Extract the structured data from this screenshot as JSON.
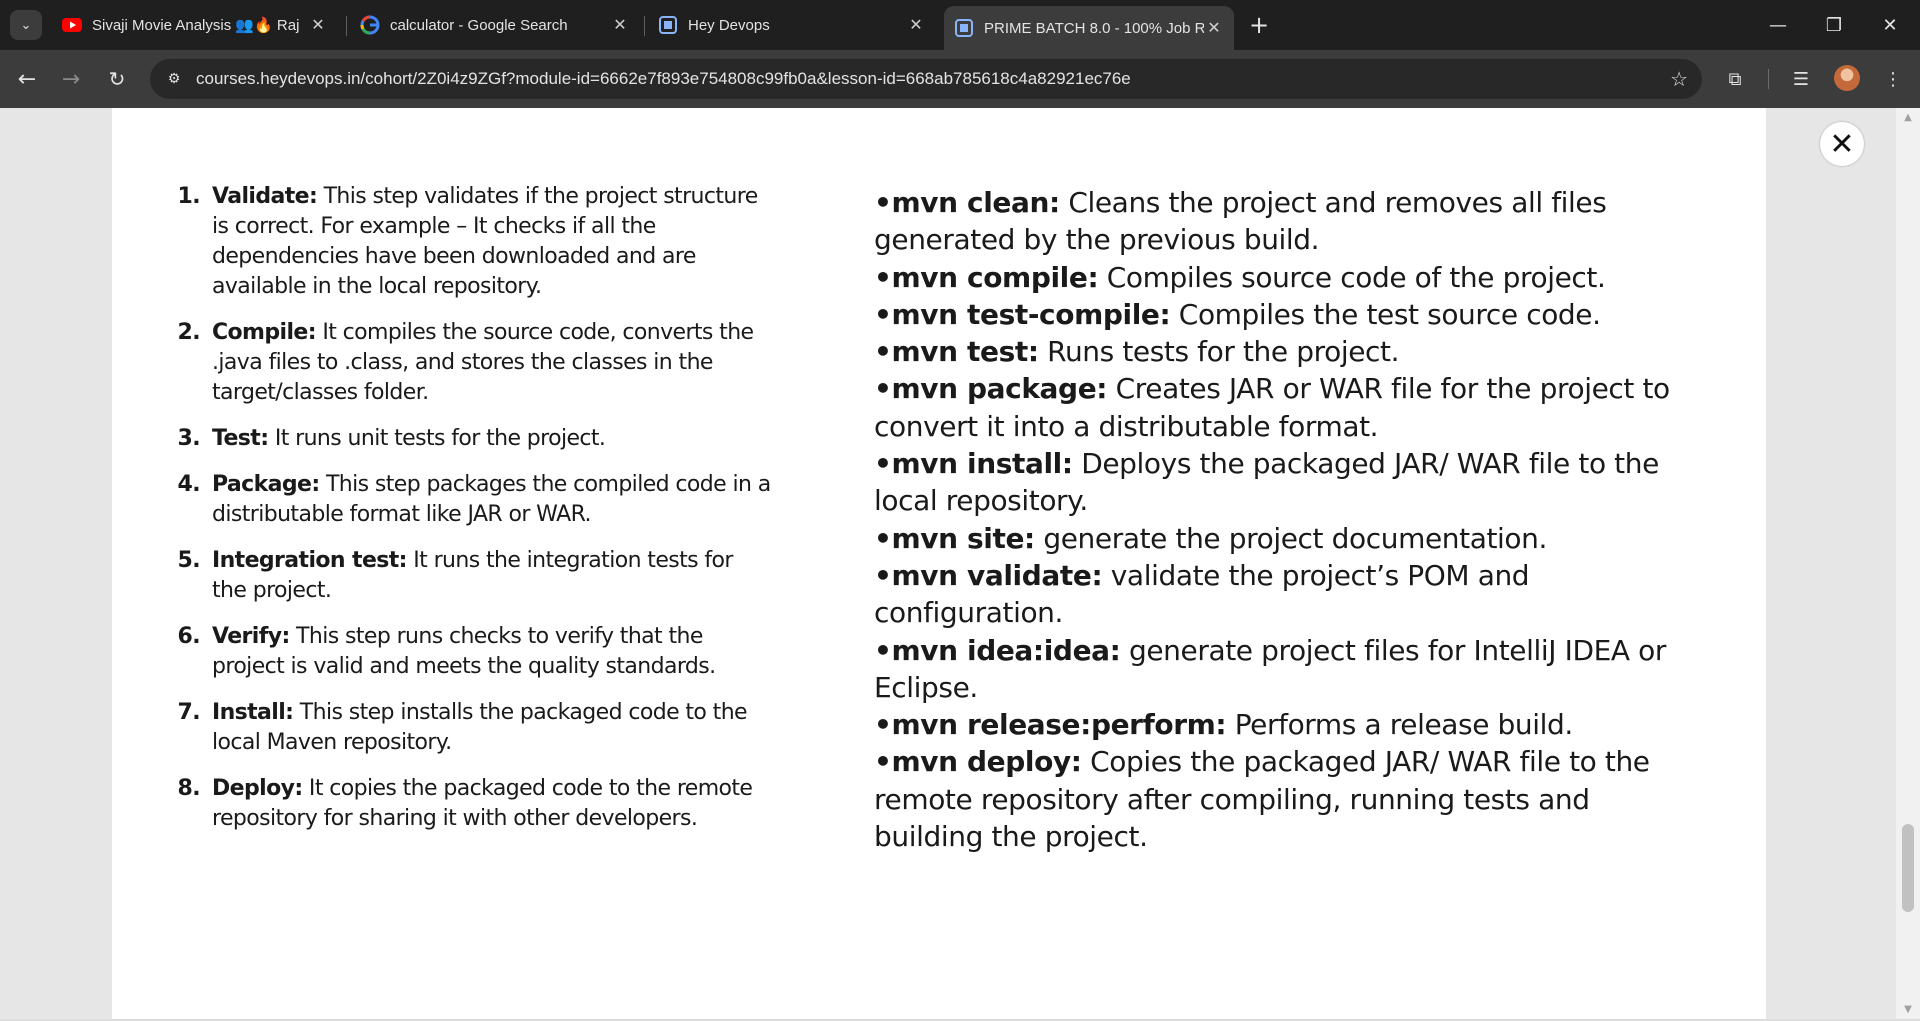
{
  "browser": {
    "tabs": [
      {
        "title": "Sivaji Movie Analysis 👥🔥 Raj",
        "icon": "youtube-icon"
      },
      {
        "title": "calculator - Google Search",
        "icon": "google-icon"
      },
      {
        "title": "Hey Devops",
        "icon": "site-icon"
      },
      {
        "title": "PRIME BATCH 8.0 - 100% Job R",
        "icon": "site-icon"
      }
    ],
    "active_tab_index": 3,
    "new_tab_label": "+",
    "url": "courses.heydevops.in/cohort/2Z0i4z9ZGf?module-id=6662e7f893e754808c99fb0a&lesson-id=668ab785618c4a82921ec76e"
  },
  "lesson": {
    "steps": [
      {
        "num": "1.",
        "term": "Validate:",
        "text": " This step validates if the project structure is correct. For example – It checks if all the dependencies have been downloaded and are available in the local repository."
      },
      {
        "num": "2.",
        "term": "Compile:",
        "text": " It compiles the source code, converts the .java files to .class, and stores the classes in the target/classes folder."
      },
      {
        "num": "3.",
        "term": "Test:",
        "text": " It runs unit tests for the project."
      },
      {
        "num": "4.",
        "term": "Package:",
        "text": " This step packages the compiled code in a distributable format like JAR or WAR."
      },
      {
        "num": "5.",
        "term": "Integration test:",
        "text": " It runs the integration tests for the project."
      },
      {
        "num": "6.",
        "term": "Verify:",
        "text": " This step runs checks to verify that the project is valid and meets the quality standards."
      },
      {
        "num": "7.",
        "term": "Install:",
        "text": " This step installs the packaged code to the local Maven repository."
      },
      {
        "num": "8.",
        "term": "Deploy:",
        "text": " It copies the packaged code to the remote repository for sharing it with other developers."
      }
    ],
    "commands": [
      {
        "cmd": "•mvn clean:",
        "text": " Cleans the project and removes all files generated by the previous build."
      },
      {
        "cmd": "•mvn compile:",
        "text": " Compiles source code of the project."
      },
      {
        "cmd": "•mvn test-compile:",
        "text": " Compiles the test source code."
      },
      {
        "cmd": "•mvn test:",
        "text": " Runs tests for the project."
      },
      {
        "cmd": "•mvn package:",
        "text": " Creates JAR or WAR file for the project to convert it into a distributable format."
      },
      {
        "cmd": "•mvn install:",
        "text": " Deploys the packaged JAR/ WAR file to the local repository."
      },
      {
        "cmd": "•mvn site:",
        "text": " generate the project documentation."
      },
      {
        "cmd": "•mvn validate:",
        "text": " validate the project’s POM and configuration."
      },
      {
        "cmd": "•mvn idea:idea:",
        "text": " generate project files for IntelliJ IDEA or Eclipse."
      },
      {
        "cmd": "•mvn release:perform:",
        "text": " Performs a release build."
      },
      {
        "cmd": "•mvn deploy:",
        "text": " Copies the packaged JAR/ WAR file to the remote repository after compiling, running tests and building the project."
      }
    ]
  },
  "colors": {
    "tabbar_bg": "#1f1f1f",
    "toolbar_bg": "#3c3c3c",
    "page_bg": "#ffffff"
  }
}
